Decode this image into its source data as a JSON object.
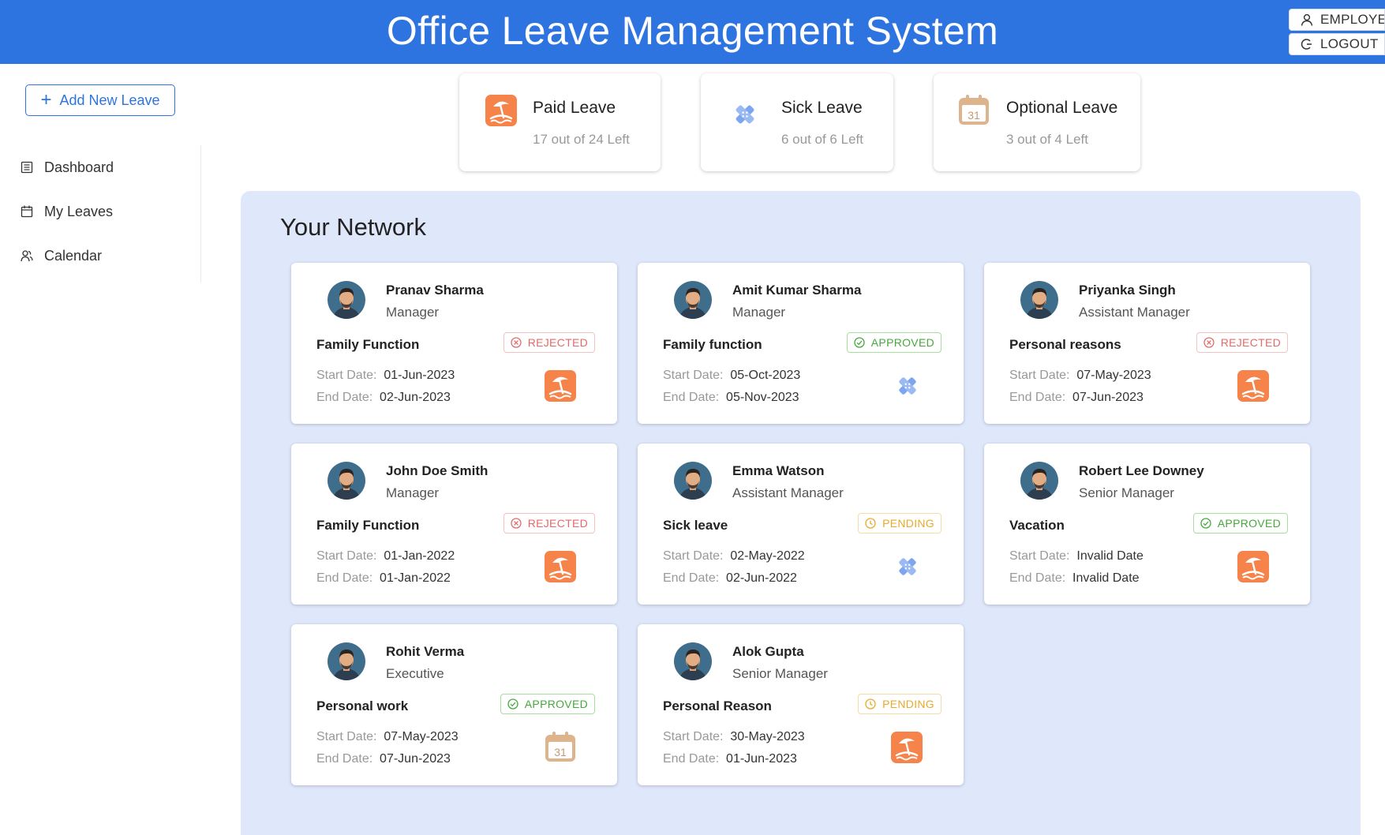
{
  "header": {
    "title": "Office Leave Management System",
    "employee_label": "EMPLOYEE",
    "logout_label": "LOGOUT"
  },
  "sidebar": {
    "add_label": "Add New Leave",
    "items": [
      {
        "label": "Dashboard",
        "icon": "list-icon"
      },
      {
        "label": "My Leaves",
        "icon": "calendar-icon"
      },
      {
        "label": "Calendar",
        "icon": "people-icon"
      }
    ]
  },
  "summary": [
    {
      "title": "Paid Leave",
      "sub": "17 out of 24 Left",
      "icon": "beach-icon"
    },
    {
      "title": "Sick Leave",
      "sub": "6 out of 6 Left",
      "icon": "bandage-icon"
    },
    {
      "title": "Optional Leave",
      "sub": "3 out of 4 Left",
      "icon": "calendar-31-icon"
    }
  ],
  "network": {
    "title": "Your Network",
    "start_label": "Start Date:",
    "end_label": "End Date:",
    "cards": [
      {
        "name": "Pranav Sharma",
        "role": "Manager",
        "reason": "Family Function",
        "status": "REJECTED",
        "start": "01-Jun-2023",
        "end": "02-Jun-2023",
        "icon": "beach-icon"
      },
      {
        "name": "Amit Kumar Sharma",
        "role": "Manager",
        "reason": "Family function",
        "status": "APPROVED",
        "start": "05-Oct-2023",
        "end": "05-Nov-2023",
        "icon": "bandage-icon"
      },
      {
        "name": "Priyanka Singh",
        "role": "Assistant Manager",
        "reason": "Personal reasons",
        "status": "REJECTED",
        "start": "07-May-2023",
        "end": "07-Jun-2023",
        "icon": "beach-icon"
      },
      {
        "name": "John Doe Smith",
        "role": "Manager",
        "reason": "Family Function",
        "status": "REJECTED",
        "start": "01-Jan-2022",
        "end": "01-Jan-2022",
        "icon": "beach-icon"
      },
      {
        "name": "Emma Watson",
        "role": "Assistant Manager",
        "reason": "Sick leave",
        "status": "PENDING",
        "start": "02-May-2022",
        "end": "02-Jun-2022",
        "icon": "bandage-icon"
      },
      {
        "name": "Robert Lee Downey",
        "role": "Senior Manager",
        "reason": "Vacation",
        "status": "APPROVED",
        "start": "Invalid Date",
        "end": "Invalid Date",
        "icon": "beach-icon"
      },
      {
        "name": "Rohit Verma",
        "role": "Executive",
        "reason": "Personal work",
        "status": "APPROVED",
        "start": "07-May-2023",
        "end": "07-Jun-2023",
        "icon": "calendar-31-icon"
      },
      {
        "name": "Alok Gupta",
        "role": "Senior Manager",
        "reason": "Personal Reason",
        "status": "PENDING",
        "start": "30-May-2023",
        "end": "01-Jun-2023",
        "icon": "beach-icon"
      }
    ]
  },
  "colors": {
    "header": "#2d74e0",
    "panel": "#dfe7fb",
    "paid": "#f5834a",
    "sick": "#7ea6f0",
    "optional": "#ddb48c",
    "rejected": "#e46a6a",
    "approved": "#46a83c",
    "pending": "#e8a92c"
  }
}
